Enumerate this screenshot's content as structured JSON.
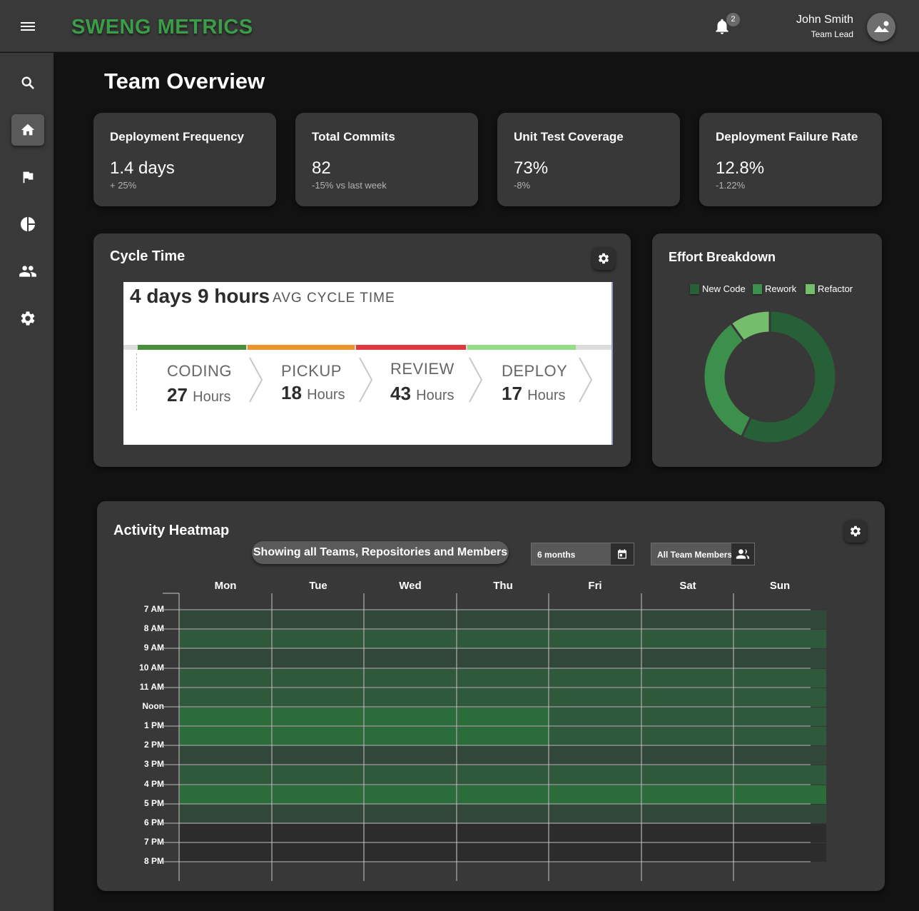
{
  "app": {
    "logo": "SWENG METRICS"
  },
  "header": {
    "notification_count": "2",
    "user_name": "John Smith",
    "user_role": "Team Lead"
  },
  "sidebar": {
    "items": [
      "search-icon",
      "home-icon",
      "flag-icon",
      "pie-chart-icon",
      "group-icon",
      "gear-icon"
    ],
    "active": "home-icon"
  },
  "page": {
    "title": "Team Overview"
  },
  "kpis": [
    {
      "label": "Deployment Frequency",
      "value": "1.4 days",
      "delta": "+ 25%"
    },
    {
      "label": "Total Commits",
      "value": "82",
      "delta": "-15% vs last week"
    },
    {
      "label": "Unit Test Coverage",
      "value": "73%",
      "delta": "-8%"
    },
    {
      "label": "Deployment Failure Rate",
      "value": "12.8%",
      "delta": "-1.22%"
    }
  ],
  "cycle_time": {
    "title": "Cycle Time",
    "total": "4 days 9 hours",
    "avg_label": "AVG CYCLE TIME",
    "phases": [
      {
        "name": "CODING",
        "value": "27",
        "unit": "Hours",
        "color": "#4b8f3c"
      },
      {
        "name": "PICKUP",
        "value": "18",
        "unit": "Hours",
        "color": "#e8962c"
      },
      {
        "name": "REVIEW",
        "value": "43",
        "unit": "Hours",
        "color": "#dd3a3f"
      },
      {
        "name": "DEPLOY",
        "value": "17",
        "unit": "Hours",
        "color": "#93dd84"
      }
    ]
  },
  "effort": {
    "title": "Effort Breakdown",
    "legend": [
      {
        "name": "New Code",
        "color": "#275f36"
      },
      {
        "name": "Rework",
        "color": "#3d8f4c"
      },
      {
        "name": "Refactor",
        "color": "#73bd6b"
      }
    ],
    "shares": [
      0.57,
      0.33,
      0.1
    ]
  },
  "heatmap": {
    "title": "Activity Heatmap",
    "filter_label": "Showing all Teams, Repositories and Members",
    "range_value": "6 months",
    "members_value": "All Team Members",
    "days": [
      "Mon",
      "Tue",
      "Wed",
      "Thu",
      "Fri",
      "Sat",
      "Sun"
    ],
    "hours": [
      "7 AM",
      "8 AM",
      "9 AM",
      "10 AM",
      "11 AM",
      "Noon",
      "1 PM",
      "2 PM",
      "3 PM",
      "4 PM",
      "5 PM",
      "6 PM",
      "7 PM",
      "8 PM"
    ],
    "levels": [
      [
        1,
        1,
        1,
        1,
        1,
        1,
        1
      ],
      [
        2,
        2,
        2,
        2,
        2,
        2,
        2
      ],
      [
        1,
        1,
        1,
        1,
        1,
        1,
        1
      ],
      [
        2,
        2,
        2,
        2,
        2,
        2,
        2
      ],
      [
        2,
        2,
        2,
        2,
        2,
        2,
        2
      ],
      [
        3,
        3,
        3,
        3,
        2,
        2,
        2
      ],
      [
        3,
        3,
        3,
        3,
        2,
        2,
        2
      ],
      [
        1,
        1,
        1,
        1,
        1,
        1,
        1
      ],
      [
        2,
        2,
        2,
        2,
        2,
        2,
        2
      ],
      [
        3,
        3,
        3,
        3,
        3,
        3,
        3
      ],
      [
        1,
        1,
        1,
        1,
        1,
        1,
        1
      ],
      [
        0,
        0,
        0,
        0,
        0,
        0,
        0
      ],
      [
        0,
        0,
        0,
        0,
        0,
        0,
        0
      ]
    ]
  }
}
